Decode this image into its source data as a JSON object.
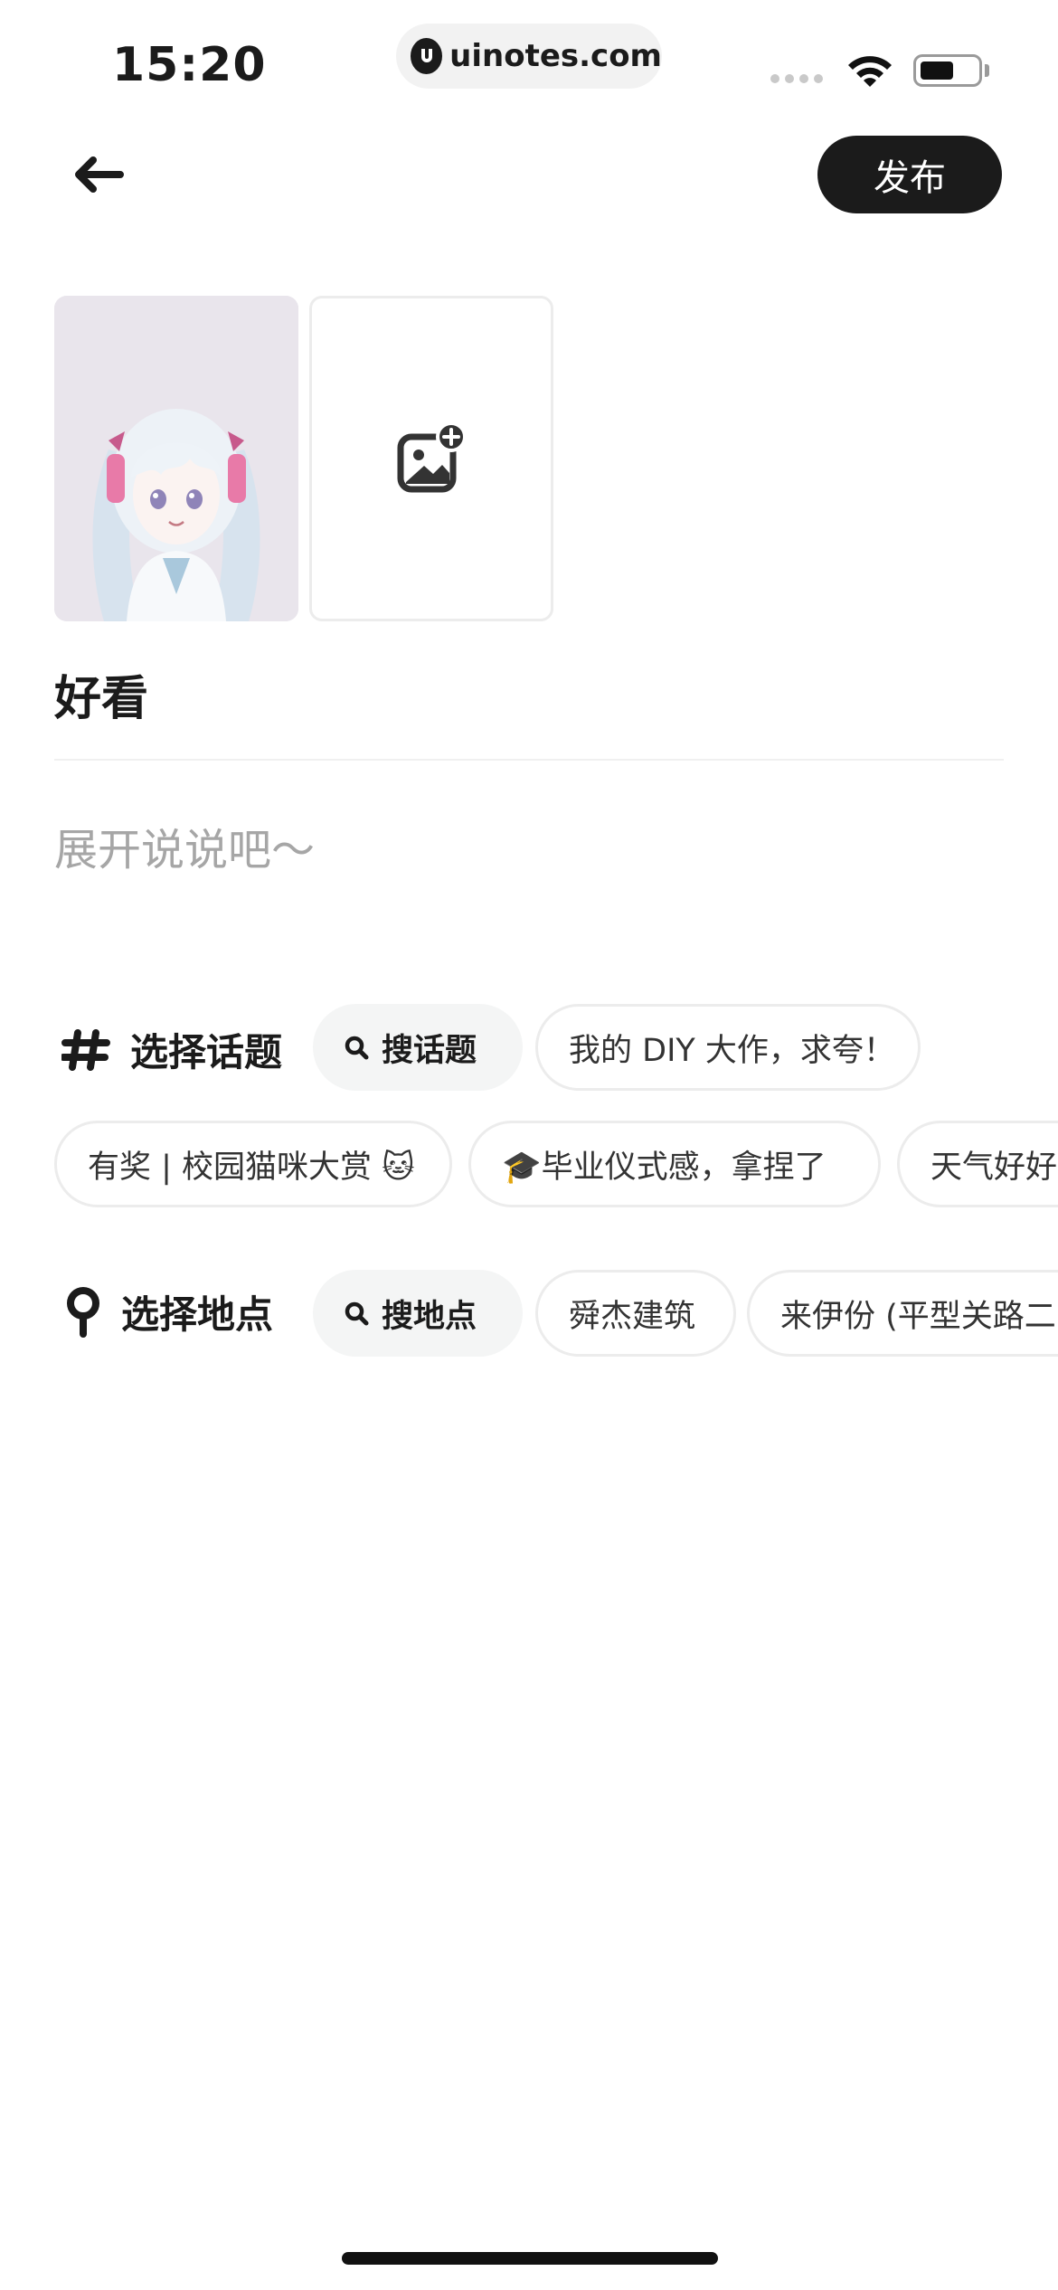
{
  "status_bar": {
    "time": "15:20",
    "url": "uinotes.com"
  },
  "header": {
    "publish_label": "发布"
  },
  "post": {
    "title": "好看",
    "body_placeholder": "展开说说吧～"
  },
  "topics": {
    "label": "选择话题",
    "search_label": "搜话题",
    "suggestions": [
      "我的 DIY 大作，求夸！",
      "有奖 | 校园猫咪大赏 🐱",
      "🎓毕业仪式感，拿捏了",
      "天气好好"
    ]
  },
  "location": {
    "label": "选择地点",
    "search_label": "搜地点",
    "suggestions": [
      "舜杰建筑",
      "来伊份 (平型关路二"
    ]
  },
  "colors": {
    "primary": "#1b1b1b",
    "placeholder": "#a6a6a6",
    "chip_border": "#ececec",
    "search_chip_bg": "#f4f5f5"
  }
}
